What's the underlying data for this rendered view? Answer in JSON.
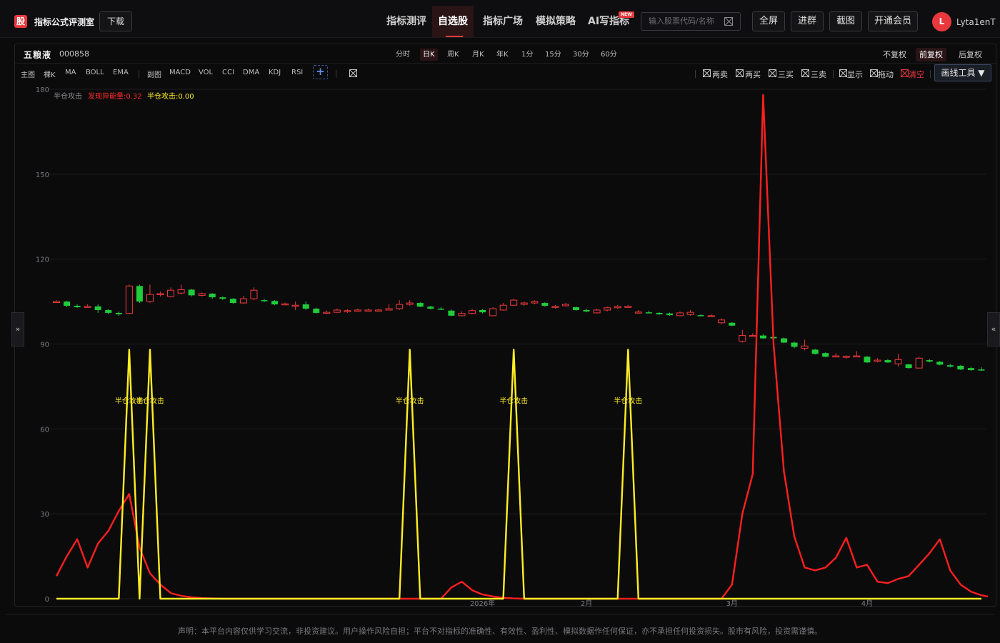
{
  "header": {
    "brand_icon_text": "股",
    "brand": "指标公式评测室",
    "download": "下载",
    "nav": [
      "指标测评",
      "自选股",
      "指标广场",
      "模拟策略",
      "AI写指标"
    ],
    "active_nav": "自选股",
    "new_badge": "NEW",
    "search_placeholder": "输入股票代码/名称",
    "buttons": [
      "全屏",
      "进群",
      "截图",
      "开通会员"
    ],
    "avatar_letter": "L",
    "username": "Lyta1enT"
  },
  "stock": {
    "name": "五粮液",
    "code": "000858"
  },
  "periods": [
    "分时",
    "日K",
    "周K",
    "月K",
    "年K",
    "1分",
    "15分",
    "30分",
    "60分"
  ],
  "active_period": "日K",
  "adjust": [
    "不复权",
    "前复权",
    "后复权"
  ],
  "active_adjust": "前复权",
  "main_label": "主图",
  "main_indicators": [
    "裸K",
    "MA",
    "BOLL",
    "EMA"
  ],
  "sub_label": "副图",
  "sub_indicators": [
    "MACD",
    "VOL",
    "CCI",
    "DMA",
    "KDJ",
    "RSI"
  ],
  "add_label": "+",
  "signal_toggles": [
    "两卖",
    "两买",
    "三买",
    "三卖"
  ],
  "view_toggles": [
    "显示",
    "拖动"
  ],
  "clear_label": "清空",
  "draw_tool": "画线工具 ▼",
  "side_left": "»",
  "side_right": "«",
  "colors": {
    "up": "#f03a3a",
    "down": "#1fcc3a",
    "spike": "#ff1f1f",
    "yellow": "#ffee22",
    "accent": "#e8383d"
  },
  "chart_data": {
    "type": "line",
    "ylim": [
      0,
      180
    ],
    "yticks": [
      0,
      30,
      60,
      90,
      120,
      150,
      180
    ],
    "xtick_labels": [
      "2026年",
      "2月",
      "3月",
      "4月"
    ],
    "xtick_index": [
      41,
      51,
      65,
      78
    ],
    "legend": [
      "半仓攻击",
      "发现异能量:0.32",
      "半仓攻击:0.00"
    ],
    "candles": [
      {
        "o": 105,
        "c": 105,
        "h": 105.5,
        "l": 104.5
      },
      {
        "o": 105,
        "c": 103.5,
        "h": 105.3,
        "l": 103
      },
      {
        "o": 103.5,
        "c": 103,
        "h": 104,
        "l": 102.7
      },
      {
        "o": 103,
        "c": 103.3,
        "h": 104,
        "l": 102.8
      },
      {
        "o": 103.3,
        "c": 102,
        "h": 104,
        "l": 101
      },
      {
        "o": 102,
        "c": 101,
        "h": 102.3,
        "l": 100.5
      },
      {
        "o": 101,
        "c": 100.5,
        "h": 101.5,
        "l": 100
      },
      {
        "o": 100.8,
        "c": 110.5,
        "h": 111,
        "l": 100.5
      },
      {
        "o": 110.5,
        "c": 105,
        "h": 111,
        "l": 104.5
      },
      {
        "o": 105,
        "c": 107.5,
        "h": 111,
        "l": 104.5
      },
      {
        "o": 107.5,
        "c": 107.8,
        "h": 108.5,
        "l": 106.8
      },
      {
        "o": 106.8,
        "c": 109,
        "h": 110,
        "l": 106.5
      },
      {
        "o": 108,
        "c": 109.2,
        "h": 111,
        "l": 107.5
      },
      {
        "o": 109.2,
        "c": 107.2,
        "h": 109.5,
        "l": 106.8
      },
      {
        "o": 107.2,
        "c": 107.8,
        "h": 108.2,
        "l": 106.8
      },
      {
        "o": 107.8,
        "c": 106.5,
        "h": 108,
        "l": 106
      },
      {
        "o": 106.5,
        "c": 106,
        "h": 106.8,
        "l": 105.5
      },
      {
        "o": 106,
        "c": 104.5,
        "h": 106.2,
        "l": 104.2
      },
      {
        "o": 104.5,
        "c": 106,
        "h": 107,
        "l": 104.2
      },
      {
        "o": 106,
        "c": 109,
        "h": 110,
        "l": 105.5
      },
      {
        "o": 105.5,
        "c": 105.2,
        "h": 106,
        "l": 104.8
      },
      {
        "o": 105.2,
        "c": 104,
        "h": 105.5,
        "l": 103.7
      },
      {
        "o": 104,
        "c": 104.2,
        "h": 104.6,
        "l": 103.7
      },
      {
        "o": 103.5,
        "c": 103.7,
        "h": 105,
        "l": 102
      },
      {
        "o": 104,
        "c": 102.5,
        "h": 105,
        "l": 102
      },
      {
        "o": 102.5,
        "c": 101,
        "h": 102.8,
        "l": 100.7
      },
      {
        "o": 101,
        "c": 101.2,
        "h": 101.8,
        "l": 100.7
      },
      {
        "o": 101.2,
        "c": 102,
        "h": 102.5,
        "l": 100.9
      },
      {
        "o": 101.5,
        "c": 101.8,
        "h": 102.3,
        "l": 101
      },
      {
        "o": 101.8,
        "c": 102,
        "h": 102.5,
        "l": 101.5
      },
      {
        "o": 101.8,
        "c": 102,
        "h": 102.5,
        "l": 101.5
      },
      {
        "o": 101.8,
        "c": 102,
        "h": 102.5,
        "l": 101.5
      },
      {
        "o": 102,
        "c": 102.5,
        "h": 104,
        "l": 102
      },
      {
        "o": 102.5,
        "c": 104,
        "h": 105.5,
        "l": 102
      },
      {
        "o": 104,
        "c": 104.5,
        "h": 105.5,
        "l": 103.5
      },
      {
        "o": 104.5,
        "c": 103.2,
        "h": 104.8,
        "l": 103
      },
      {
        "o": 103.2,
        "c": 102.5,
        "h": 103.5,
        "l": 102.2
      },
      {
        "o": 102.5,
        "c": 102.3,
        "h": 103,
        "l": 102
      },
      {
        "o": 101.8,
        "c": 100,
        "h": 102.2,
        "l": 99.8
      },
      {
        "o": 100,
        "c": 100.8,
        "h": 101.5,
        "l": 99.8
      },
      {
        "o": 100.8,
        "c": 101.8,
        "h": 102.5,
        "l": 100.5
      },
      {
        "o": 102,
        "c": 101.2,
        "h": 102.3,
        "l": 100.8
      },
      {
        "o": 100,
        "c": 102.5,
        "h": 103,
        "l": 99.8
      },
      {
        "o": 102,
        "c": 103.7,
        "h": 104.5,
        "l": 101.8
      },
      {
        "o": 103.7,
        "c": 105.5,
        "h": 106,
        "l": 103.5
      },
      {
        "o": 104,
        "c": 104.5,
        "h": 105,
        "l": 103.5
      },
      {
        "o": 104.5,
        "c": 105,
        "h": 105.5,
        "l": 104
      },
      {
        "o": 104.5,
        "c": 103.5,
        "h": 104.8,
        "l": 103.2
      },
      {
        "o": 103,
        "c": 103.3,
        "h": 103.8,
        "l": 102.5
      },
      {
        "o": 103.5,
        "c": 104,
        "h": 104.5,
        "l": 103.2
      },
      {
        "o": 103,
        "c": 102,
        "h": 103.3,
        "l": 101.7
      },
      {
        "o": 102,
        "c": 101.5,
        "h": 102.5,
        "l": 101.2
      },
      {
        "o": 101,
        "c": 102,
        "h": 102.5,
        "l": 100.8
      },
      {
        "o": 102,
        "c": 102.8,
        "h": 103.2,
        "l": 101.5
      },
      {
        "o": 102.8,
        "c": 103.3,
        "h": 103.8,
        "l": 102.5
      },
      {
        "o": 103.3,
        "c": 103.3,
        "h": 103.8,
        "l": 103
      },
      {
        "o": 101.3,
        "c": 101.3,
        "h": 102,
        "l": 100.8
      },
      {
        "o": 101.2,
        "c": 101,
        "h": 101.8,
        "l": 100.8
      },
      {
        "o": 101,
        "c": 100.5,
        "h": 101.2,
        "l": 100.3
      },
      {
        "o": 100.8,
        "c": 100.2,
        "h": 101.1,
        "l": 100
      },
      {
        "o": 100,
        "c": 101,
        "h": 101.5,
        "l": 99.8
      },
      {
        "o": 100.4,
        "c": 101.2,
        "h": 102,
        "l": 100
      },
      {
        "o": 100.2,
        "c": 100,
        "h": 100.5,
        "l": 99.8
      },
      {
        "o": 100,
        "c": 100,
        "h": 100.5,
        "l": 99.7
      },
      {
        "o": 97.5,
        "c": 98.5,
        "h": 99,
        "l": 97
      },
      {
        "o": 97.5,
        "c": 96.5,
        "h": 97.8,
        "l": 96.3
      },
      {
        "o": 91,
        "c": 93,
        "h": 95,
        "l": 90.5
      },
      {
        "o": 93,
        "c": 93,
        "h": 93.8,
        "l": 92.5
      },
      {
        "o": 93,
        "c": 92,
        "h": 93.5,
        "l": 91.8
      },
      {
        "o": 92.5,
        "c": 92,
        "h": 93,
        "l": 91.7
      },
      {
        "o": 92,
        "c": 90.5,
        "h": 92.3,
        "l": 90.3
      },
      {
        "o": 90.5,
        "c": 89,
        "h": 90.8,
        "l": 88.5
      },
      {
        "o": 88.5,
        "c": 89.3,
        "h": 91.5,
        "l": 87.8
      },
      {
        "o": 88,
        "c": 86.5,
        "h": 88.3,
        "l": 86.3
      },
      {
        "o": 86.8,
        "c": 85.5,
        "h": 87,
        "l": 85.3
      },
      {
        "o": 85.8,
        "c": 85.8,
        "h": 86.8,
        "l": 85.3
      },
      {
        "o": 85.3,
        "c": 85.7,
        "h": 86,
        "l": 84.8
      },
      {
        "o": 85.8,
        "c": 85.8,
        "h": 87.5,
        "l": 85.5
      },
      {
        "o": 85.5,
        "c": 83.5,
        "h": 85.8,
        "l": 83.3
      },
      {
        "o": 84,
        "c": 84.3,
        "h": 85,
        "l": 83.5
      },
      {
        "o": 84.3,
        "c": 83.5,
        "h": 84.7,
        "l": 83.3
      },
      {
        "o": 83,
        "c": 84.5,
        "h": 86.5,
        "l": 82
      },
      {
        "o": 82.8,
        "c": 81.5,
        "h": 83,
        "l": 81.3
      },
      {
        "o": 81.5,
        "c": 85,
        "h": 85.5,
        "l": 81.3
      },
      {
        "o": 84.3,
        "c": 83.8,
        "h": 84.7,
        "l": 83.5
      },
      {
        "o": 83.7,
        "c": 82.7,
        "h": 84,
        "l": 82.5
      },
      {
        "o": 82.5,
        "c": 82,
        "h": 83,
        "l": 81.7
      },
      {
        "o": 82.3,
        "c": 81,
        "h": 82.6,
        "l": 80.8
      },
      {
        "o": 81.5,
        "c": 80.8,
        "h": 82,
        "l": 80.5
      },
      {
        "o": 81,
        "c": 80.8,
        "h": 81.8,
        "l": 80.5
      }
    ],
    "series": [
      {
        "name": "发现异能量",
        "color": "#ff1f1f",
        "values": [
          8,
          15,
          21,
          11,
          19.5,
          24,
          31,
          37,
          18,
          9,
          5,
          2,
          1,
          0.5,
          0.2,
          0.1,
          0,
          0,
          0,
          0,
          0,
          0,
          0,
          0,
          0,
          0,
          0,
          0,
          0,
          0,
          0,
          0,
          0,
          0,
          0,
          0,
          0,
          0,
          4,
          6,
          3,
          1.5,
          0.8,
          0.3,
          0.1,
          0,
          0,
          0,
          0,
          0,
          0,
          0,
          0,
          0,
          0,
          0,
          0,
          0,
          0,
          0,
          0,
          0,
          0,
          0,
          0,
          5,
          30,
          44,
          178,
          90,
          45,
          22,
          11,
          10,
          11,
          14.5,
          21.5,
          11,
          12,
          6,
          5.5,
          7,
          8,
          12,
          16,
          21,
          10,
          5,
          2.5,
          1.2,
          0.5,
          0
        ]
      },
      {
        "name": "半仓攻击",
        "color": "#ffee22",
        "values": [
          0,
          0,
          0,
          0,
          0,
          0,
          0,
          88,
          0,
          88,
          0,
          0,
          0,
          0,
          0,
          0,
          0,
          0,
          0,
          0,
          0,
          0,
          0,
          0,
          0,
          0,
          0,
          0,
          0,
          0,
          0,
          0,
          0,
          0,
          88,
          0,
          0,
          0,
          0,
          0,
          0,
          0,
          0,
          0,
          88,
          0,
          0,
          0,
          0,
          0,
          0,
          0,
          0,
          0,
          0,
          88,
          0,
          0,
          0,
          0,
          0,
          0,
          0,
          0,
          0,
          0,
          0,
          0,
          0,
          0,
          0,
          0,
          0,
          0,
          0,
          0,
          0,
          0,
          0,
          0,
          0,
          0,
          0,
          0,
          0,
          0,
          0,
          0,
          0,
          0
        ]
      }
    ],
    "annotations": [
      {
        "index": 7,
        "label": "半仓攻击"
      },
      {
        "index": 9,
        "label": "半仓攻击"
      },
      {
        "index": 34,
        "label": "半仓攻击"
      },
      {
        "index": 44,
        "label": "半仓攻击"
      },
      {
        "index": 55,
        "label": "半仓攻击"
      }
    ]
  },
  "disclaimer": "声明：本平台内容仅供学习交流，非投资建议。用户操作风险自担；平台不对指标的准确性、有效性、盈利性、模拟数据作任何保证，亦不承担任何投资损失。股市有风险，投资需谨慎。"
}
